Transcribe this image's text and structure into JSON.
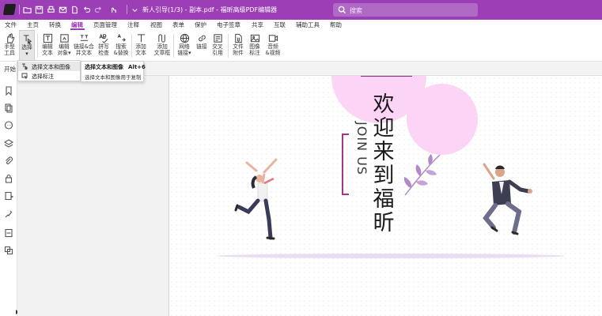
{
  "titlebar": {
    "title": "新人引导(1/3) - 副本.pdf - 福昕高级PDF编辑器",
    "search_placeholder": "搜索",
    "accent": "#9c3fb6"
  },
  "menu": {
    "items": [
      "文件",
      "主页",
      "转换",
      "编辑",
      "页面管理",
      "注释",
      "视图",
      "表单",
      "保护",
      "电子签章",
      "共享",
      "互联",
      "辅助工具",
      "帮助"
    ],
    "active": "编辑"
  },
  "toolbar": {
    "tools": [
      {
        "label1": "手型",
        "label2": "工具",
        "icon": "hand-icon"
      },
      {
        "label1": "选择",
        "label2": "▾",
        "icon": "select-text-icon"
      },
      {
        "label1": "编辑",
        "label2": "文本",
        "icon": "edit-text-icon"
      },
      {
        "label1": "编辑",
        "label2": "对象▾",
        "icon": "edit-object-icon"
      },
      {
        "label1": "链接&合",
        "label2": "并文本",
        "icon": "link-merge-text-icon"
      },
      {
        "label1": "拼写",
        "label2": "检查",
        "icon": "spell-check-icon"
      },
      {
        "label1": "搜索",
        "label2": "&替换",
        "icon": "search-replace-icon"
      },
      {
        "label1": "添加",
        "label2": "文本",
        "icon": "add-text-icon"
      },
      {
        "label1": "添加",
        "label2": "文章框",
        "icon": "add-article-icon"
      },
      {
        "label1": "网络",
        "label2": "链接▾",
        "icon": "web-link-icon"
      },
      {
        "label1": "链接",
        "label2": "",
        "icon": "link-icon"
      },
      {
        "label1": "交叉",
        "label2": "引用",
        "icon": "cross-reference-icon"
      },
      {
        "label1": "文件",
        "label2": "附件",
        "icon": "file-attachment-icon"
      },
      {
        "label1": "图像",
        "label2": "标注",
        "icon": "image-annotation-icon"
      },
      {
        "label1": "音频",
        "label2": "&视频",
        "icon": "audio-video-icon"
      }
    ]
  },
  "tab": {
    "label": "开始"
  },
  "dropdown": {
    "items": [
      "选择文本和图像",
      "选择标注"
    ]
  },
  "tooltip": {
    "title": "选择文本和图像",
    "shortcut": "Alt+6",
    "description": "选择文本和图像用于复制"
  },
  "page": {
    "headline_chars": [
      "欢",
      "迎",
      "来",
      "到",
      "福",
      "昕"
    ],
    "join_us": "JOIN US",
    "colors": {
      "purple_dark": "#a0378c",
      "pink_light": "#fbd4f6",
      "lavender": "#b189c9"
    }
  }
}
